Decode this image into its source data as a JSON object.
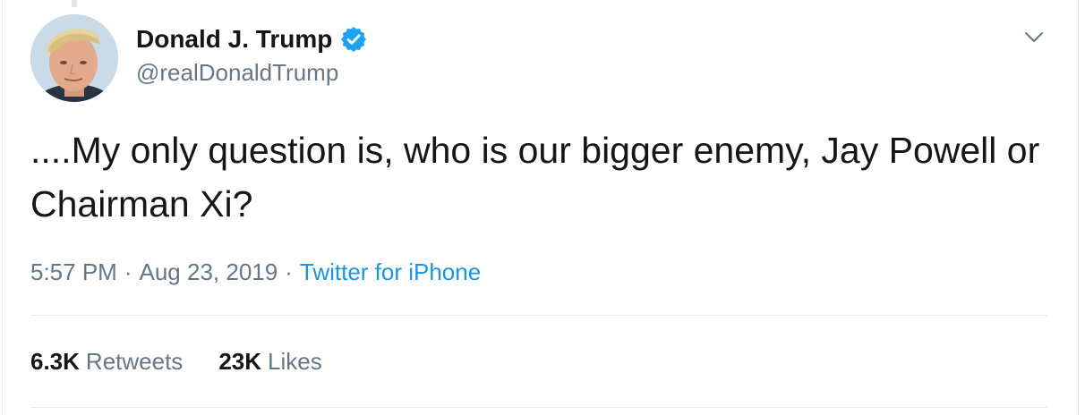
{
  "tweet": {
    "author": {
      "display_name": "Donald J. Trump",
      "handle": "@realDonaldTrump",
      "verified": true
    },
    "text": "....My only question is, who is our bigger enemy, Jay Powell or Chairman Xi?",
    "time": "5:57 PM",
    "date": "Aug 23, 2019",
    "separator": "·",
    "source": "Twitter for iPhone",
    "stats": {
      "retweets_count": "6.3K",
      "retweets_label": "Retweets",
      "likes_count": "23K",
      "likes_label": "Likes"
    }
  },
  "icons": {
    "verified": "verified-badge-icon",
    "caret": "chevron-down-icon"
  },
  "colors": {
    "text_primary": "#14171a",
    "text_secondary": "#657786",
    "link": "#1b95e0",
    "verified_blue": "#1da1f2",
    "divider": "#e6ecf0"
  }
}
